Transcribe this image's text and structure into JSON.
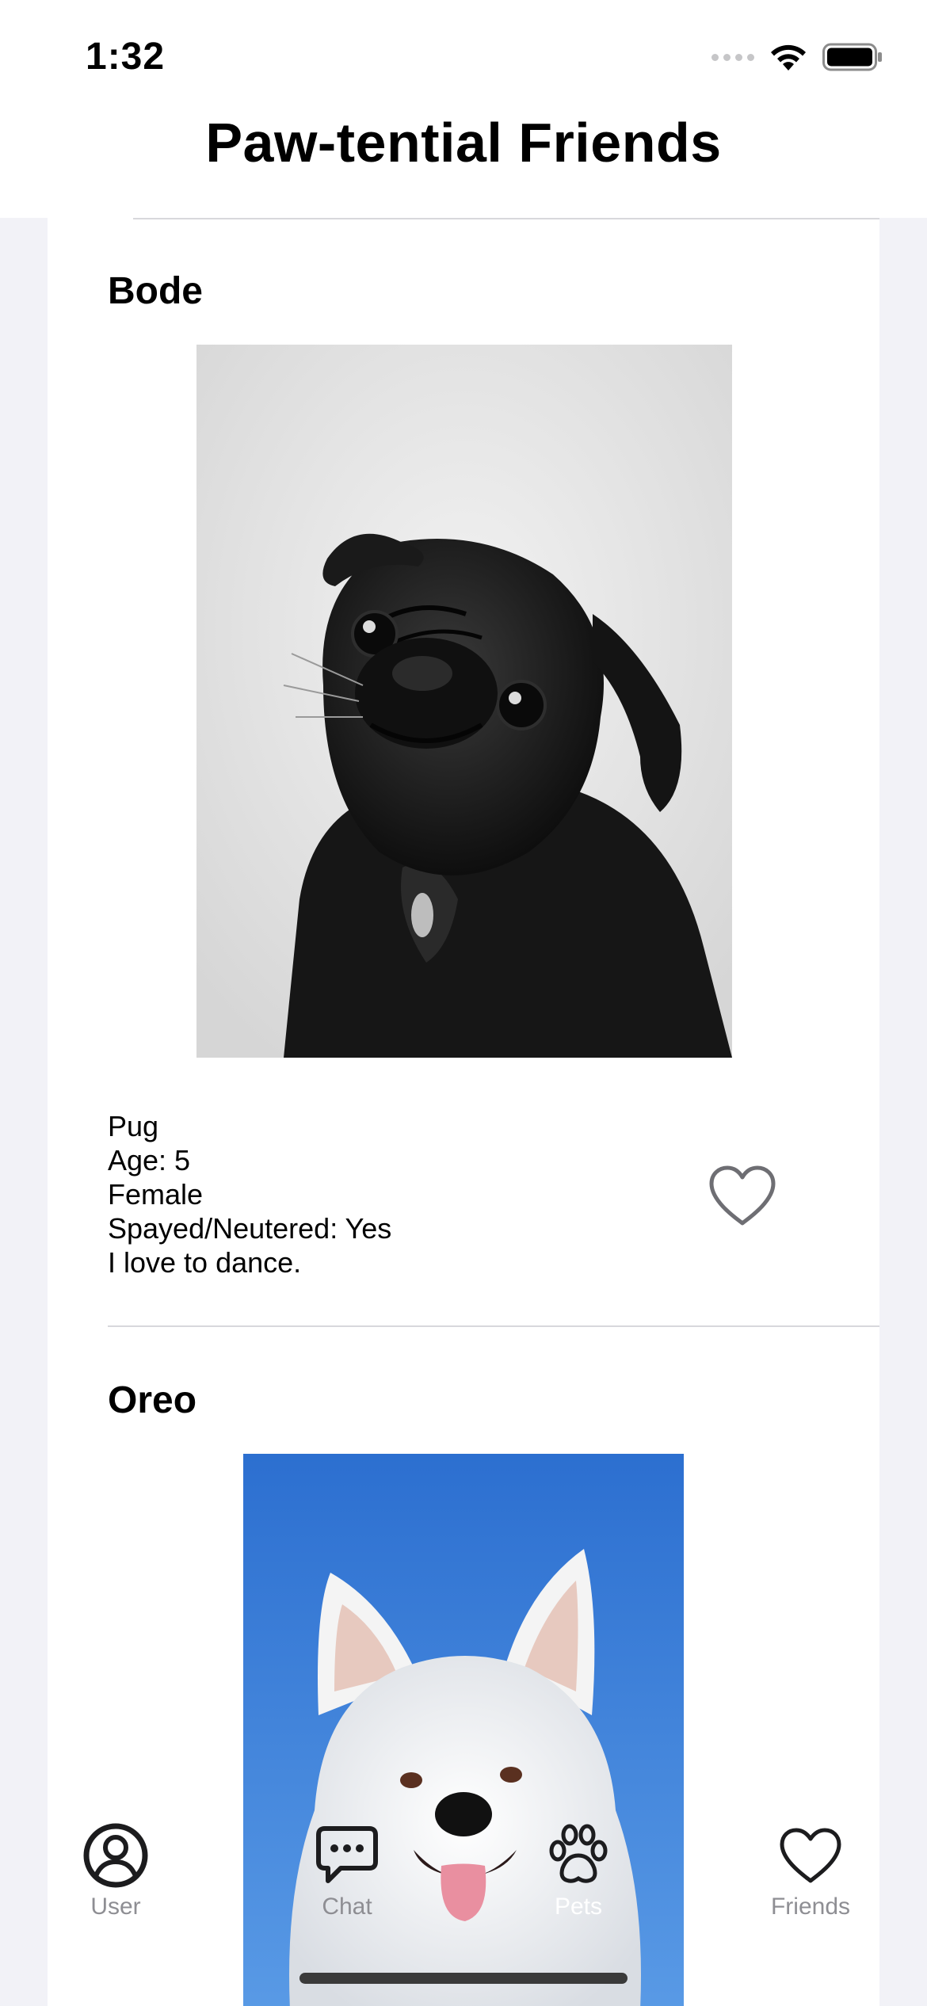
{
  "status_bar": {
    "time": "1:32"
  },
  "nav": {
    "title": "Paw-tential Friends"
  },
  "pets": [
    {
      "name": "Bode",
      "breed": "Pug",
      "age": "Age: 5",
      "sex": "Female",
      "spayed": "Spayed/Neutered: Yes",
      "bio": "I love to dance.",
      "liked": false,
      "photo_desc_icon": "black-pug-photo"
    },
    {
      "name": "Oreo",
      "photo_desc_icon": "white-dog-photo"
    }
  ],
  "tabs": [
    {
      "label": "User",
      "icon": "person-circle-icon",
      "active": false
    },
    {
      "label": "Chat",
      "icon": "chat-bubble-icon",
      "active": false
    },
    {
      "label": "Pets",
      "icon": "paw-icon",
      "active": true
    },
    {
      "label": "Friends",
      "icon": "heart-icon",
      "active": false
    }
  ],
  "colors": {
    "tab_inactive": "#8e8e93",
    "tab_active": "#ffffff",
    "heart_outline": "#6e6e73",
    "sky_blue": "#3a82d8"
  }
}
